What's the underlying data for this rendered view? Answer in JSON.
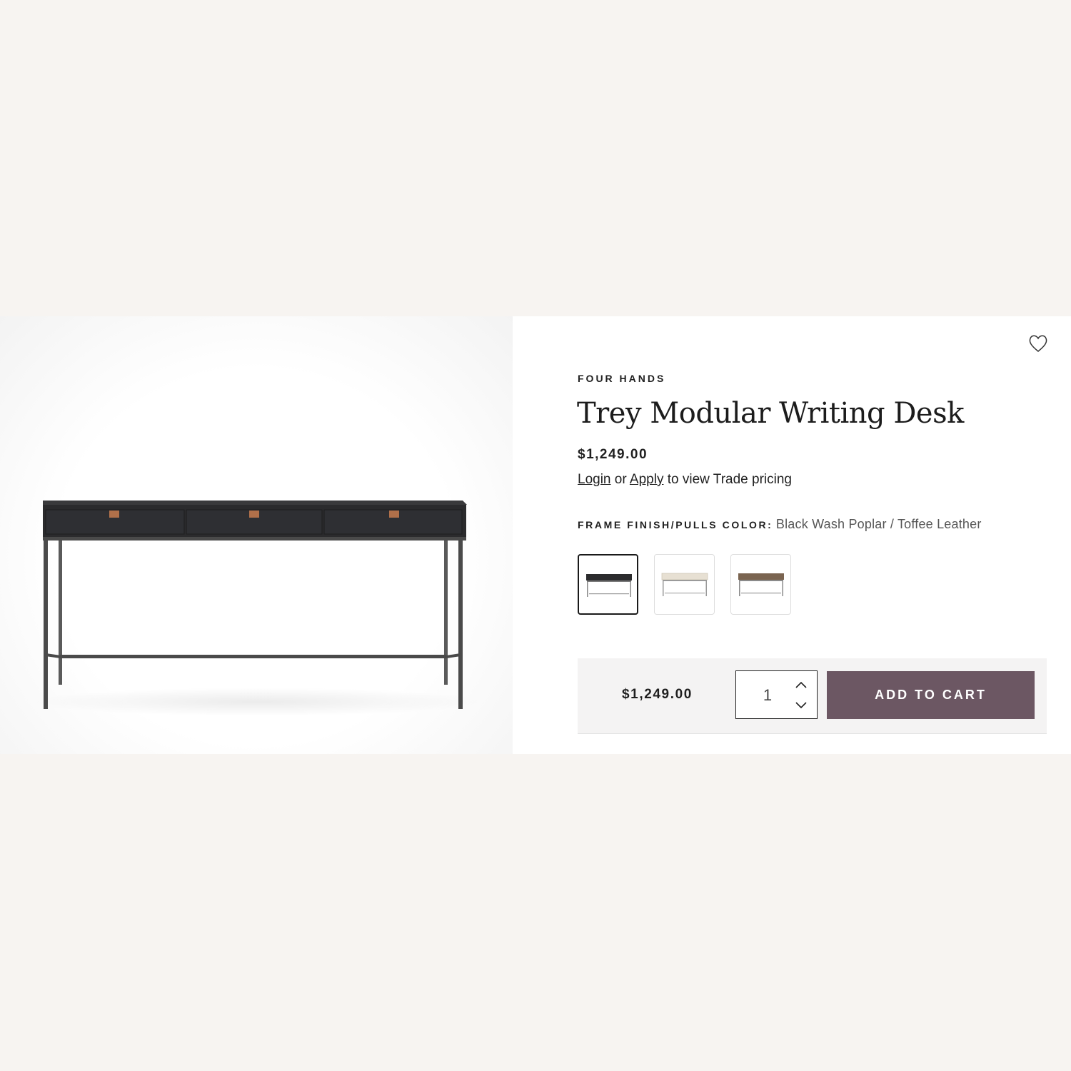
{
  "product": {
    "brand": "FOUR HANDS",
    "title": "Trey Modular Writing Desk",
    "price": "$1,249.00",
    "image_icon": "writing-desk-photo"
  },
  "trade": {
    "login_label": "Login",
    "or_text": "or",
    "apply_label": "Apply",
    "suffix_text": "to view Trade pricing"
  },
  "option": {
    "label": "FRAME FINISH/PULLS COLOR:",
    "selected_value": "Black Wash Poplar / Toffee Leather",
    "swatches": [
      {
        "finish_color": "#2b2b2d",
        "selected": true
      },
      {
        "finish_color": "#e7e0d3",
        "selected": false
      },
      {
        "finish_color": "#7a6450",
        "selected": false
      }
    ]
  },
  "cart": {
    "price": "$1,249.00",
    "quantity": "1",
    "add_label": "ADD TO CART"
  },
  "colors": {
    "page_background": "#f7f4f1",
    "card_background": "#ffffff",
    "cart_bar": "#f4f3f3",
    "button": "#6c5763",
    "desk_wood": "#2b2b2d",
    "pulls": "#b0704a",
    "frame_metal": "#4a4a4a"
  }
}
